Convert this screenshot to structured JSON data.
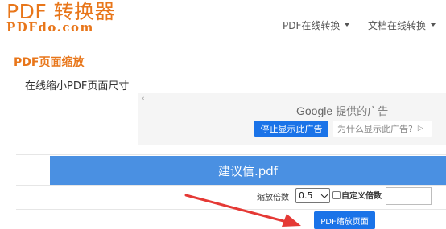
{
  "header": {
    "logo_main": "PDF 转换器",
    "logo_sub": "PDFdo.com",
    "nav": [
      {
        "label": "PDF在线转换"
      },
      {
        "label": "文档在线转换"
      }
    ]
  },
  "page": {
    "title": "PDF页面缩放",
    "subtitle": "在线缩小PDF页面尺寸"
  },
  "ad": {
    "back_glyph": "‹",
    "brand": "Google",
    "brand_suffix": "提供的广告",
    "stop_label": "停止显示此广告",
    "why_label": "为什么显示此广告?",
    "why_icon": "▷"
  },
  "file": {
    "name": "建议信.pdf"
  },
  "options": {
    "scale_label": "缩放倍数",
    "scale_value": "0.5",
    "custom_label": "自定义倍数",
    "custom_value": ""
  },
  "submit": {
    "label": "PDF缩放页面"
  },
  "colors": {
    "brand_orange": "#e8761a",
    "file_bar_blue": "#4a90e2",
    "button_blue": "#1a73e8",
    "annotation_red": "#e53935"
  }
}
